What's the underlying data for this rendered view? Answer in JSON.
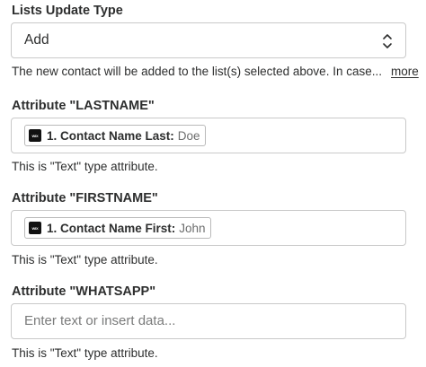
{
  "lists_update_type": {
    "label": "Lists Update Type",
    "selected_value": "Add",
    "helper_text": "The new contact will be added to the list(s) selected above. In case...",
    "more_link": "more"
  },
  "lastname": {
    "label": "Attribute \"LASTNAME\"",
    "pill_label": "1. Contact Name Last:",
    "pill_value": "Doe",
    "helper_text": "This is \"Text\" type attribute."
  },
  "firstname": {
    "label": "Attribute \"FIRSTNAME\"",
    "pill_label": "1. Contact Name First:",
    "pill_value": "John",
    "helper_text": "This is \"Text\" type attribute."
  },
  "whatsapp": {
    "label": "Attribute \"WHATSAPP\"",
    "placeholder": "Enter text or insert data...",
    "helper_text": "This is \"Text\" type attribute."
  },
  "icons": {
    "select": "chevron-up-down-icon",
    "pill_app": "wix-app-icon"
  },
  "app_icon_text": "WIX"
}
